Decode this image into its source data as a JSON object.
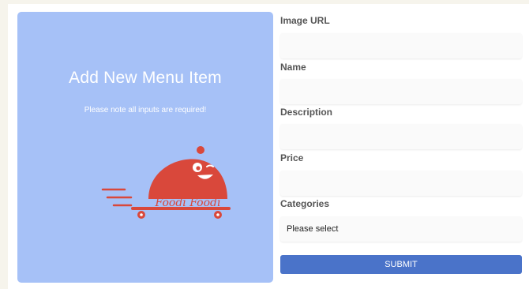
{
  "panel": {
    "title": "Add New Menu Item",
    "note": "Please note all inputs are required!",
    "logo_text": "Foodi Foodi"
  },
  "form": {
    "image_url_label": "Image URL",
    "name_label": "Name",
    "description_label": "Description",
    "price_label": "Price",
    "categories_label": "Categories",
    "categories_selected": "Please select",
    "submit_label": "SUBMIT"
  },
  "colors": {
    "panel_bg": "#a6c1f7",
    "logo_red": "#d9483b",
    "submit_bg": "#4a73c9"
  }
}
